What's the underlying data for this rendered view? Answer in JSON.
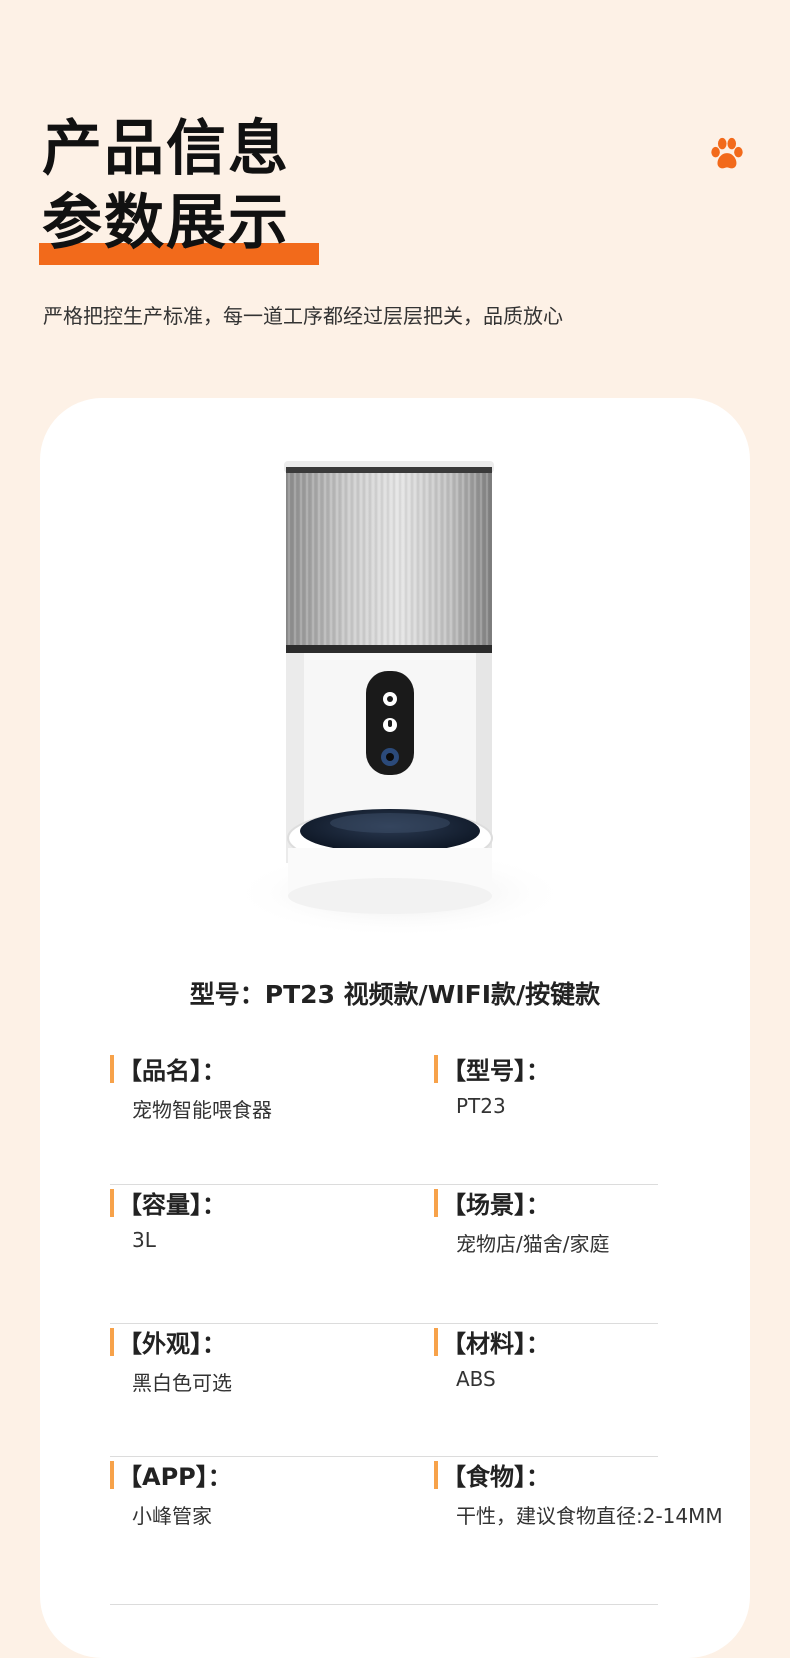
{
  "header": {
    "title_line1": "产品信息",
    "title_line2": "参数展示",
    "subtitle": "严格把控生产标准，每一道工序都经过层层把关，品质放心",
    "accent_color": "#f26a1b",
    "paw_icon": "paw-icon"
  },
  "product": {
    "image": "pet-feeder-image",
    "model_line": "型号：PT23 视频款/WIFI款/按键款"
  },
  "specs": [
    {
      "left": {
        "label": "【品名】：",
        "value": "宠物智能喂食器"
      },
      "right": {
        "label": "【型号】：",
        "value": "PT23"
      }
    },
    {
      "left": {
        "label": "【容量】：",
        "value": "3L"
      },
      "right": {
        "label": "【场景】：",
        "value": "宠物店/猫舍/家庭"
      }
    },
    {
      "left": {
        "label": "【外观】：",
        "value": "黑白色可选"
      },
      "right": {
        "label": "【材料】：",
        "value": "ABS"
      }
    },
    {
      "left": {
        "label": "【APP】：",
        "value": "小峰管家"
      },
      "right": {
        "label": "【食物】：",
        "value": "干性，建议食物直径:2-14MM"
      }
    }
  ],
  "colors": {
    "background": "#fdf1e6",
    "card": "#ffffff",
    "label_bar": "#f7a24a"
  }
}
